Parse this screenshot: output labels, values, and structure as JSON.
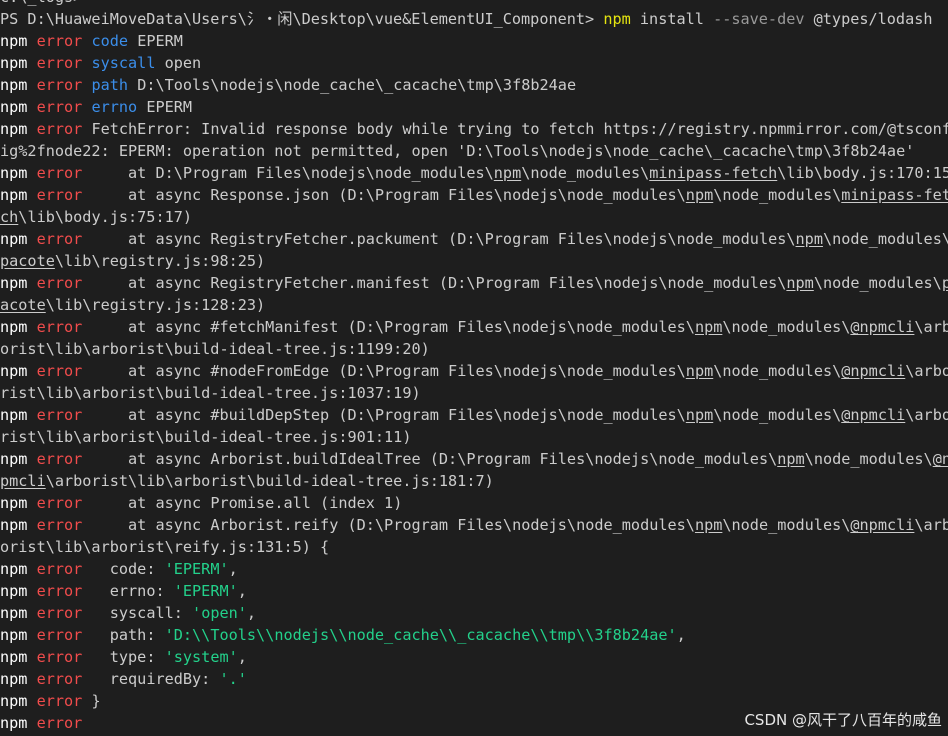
{
  "terminal": {
    "lines": [
      [
        {
          "t": "c:\\_logs>"
        }
      ],
      [
        {
          "t": "PS D:\\HuaweiMoveData\\Users\\氵・闲\\Desktop\\vue&ElementUI_Component> "
        },
        {
          "t": "npm",
          "c": "cmd"
        },
        {
          "t": " install "
        },
        {
          "t": "--save-dev",
          "c": "flag"
        },
        {
          "t": " @types/lodash"
        }
      ],
      [
        {
          "t": "npm",
          "c": "npm"
        },
        {
          "t": " "
        },
        {
          "t": "error",
          "c": "lvl"
        },
        {
          "t": " "
        },
        {
          "t": "code",
          "c": "key"
        },
        {
          "t": " EPERM"
        }
      ],
      [
        {
          "t": "npm",
          "c": "npm"
        },
        {
          "t": " "
        },
        {
          "t": "error",
          "c": "lvl"
        },
        {
          "t": " "
        },
        {
          "t": "syscall",
          "c": "key"
        },
        {
          "t": " open"
        }
      ],
      [
        {
          "t": "npm",
          "c": "npm"
        },
        {
          "t": " "
        },
        {
          "t": "error",
          "c": "lvl"
        },
        {
          "t": " "
        },
        {
          "t": "path",
          "c": "key"
        },
        {
          "t": " D:\\Tools\\nodejs\\node_cache\\_cacache\\tmp\\3f8b24ae"
        }
      ],
      [
        {
          "t": "npm",
          "c": "npm"
        },
        {
          "t": " "
        },
        {
          "t": "error",
          "c": "lvl"
        },
        {
          "t": " "
        },
        {
          "t": "errno",
          "c": "key"
        },
        {
          "t": " EPERM"
        }
      ],
      [
        {
          "t": "npm",
          "c": "npm"
        },
        {
          "t": " "
        },
        {
          "t": "error",
          "c": "lvl"
        },
        {
          "t": " FetchError: Invalid response body while trying to fetch https://registry.npmmirror.com/@tsconf"
        }
      ],
      [
        {
          "t": "ig%2fnode22: EPERM: operation not permitted, open 'D:\\Tools\\nodejs\\node_cache\\_cacache\\tmp\\3f8b24ae'"
        }
      ],
      [
        {
          "t": "npm",
          "c": "npm"
        },
        {
          "t": " "
        },
        {
          "t": "error",
          "c": "lvl"
        },
        {
          "t": "     at D:\\Program Files\\nodejs\\node_modules\\"
        },
        {
          "t": "npm",
          "c": "u"
        },
        {
          "t": "\\node_modules\\"
        },
        {
          "t": "minipass-fetch",
          "c": "u"
        },
        {
          "t": "\\lib\\body.js:170:15"
        }
      ],
      [
        {
          "t": "npm",
          "c": "npm"
        },
        {
          "t": " "
        },
        {
          "t": "error",
          "c": "lvl"
        },
        {
          "t": "     at async Response.json (D:\\Program Files\\nodejs\\node_modules\\"
        },
        {
          "t": "npm",
          "c": "u"
        },
        {
          "t": "\\node_modules\\"
        },
        {
          "t": "minipass-fet",
          "c": "u"
        }
      ],
      [
        {
          "t": "ch",
          "c": "u"
        },
        {
          "t": "\\lib\\body.js:75:17)"
        }
      ],
      [
        {
          "t": "npm",
          "c": "npm"
        },
        {
          "t": " "
        },
        {
          "t": "error",
          "c": "lvl"
        },
        {
          "t": "     at async RegistryFetcher.packument (D:\\Program Files\\nodejs\\node_modules\\"
        },
        {
          "t": "npm",
          "c": "u"
        },
        {
          "t": "\\node_modules\\"
        }
      ],
      [
        {
          "t": "pacote",
          "c": "u"
        },
        {
          "t": "\\lib\\registry.js:98:25)"
        }
      ],
      [
        {
          "t": "npm",
          "c": "npm"
        },
        {
          "t": " "
        },
        {
          "t": "error",
          "c": "lvl"
        },
        {
          "t": "     at async RegistryFetcher.manifest (D:\\Program Files\\nodejs\\node_modules\\"
        },
        {
          "t": "npm",
          "c": "u"
        },
        {
          "t": "\\node_modules\\"
        },
        {
          "t": "p",
          "c": "u"
        }
      ],
      [
        {
          "t": "acote",
          "c": "u"
        },
        {
          "t": "\\lib\\registry.js:128:23)"
        }
      ],
      [
        {
          "t": "npm",
          "c": "npm"
        },
        {
          "t": " "
        },
        {
          "t": "error",
          "c": "lvl"
        },
        {
          "t": "     at async #fetchManifest (D:\\Program Files\\nodejs\\node_modules\\"
        },
        {
          "t": "npm",
          "c": "u"
        },
        {
          "t": "\\node_modules\\"
        },
        {
          "t": "@npmcli",
          "c": "u"
        },
        {
          "t": "\\arb"
        }
      ],
      [
        {
          "t": "orist\\lib\\arborist\\build-ideal-tree.js:1199:20)"
        }
      ],
      [
        {
          "t": "npm",
          "c": "npm"
        },
        {
          "t": " "
        },
        {
          "t": "error",
          "c": "lvl"
        },
        {
          "t": "     at async #nodeFromEdge (D:\\Program Files\\nodejs\\node_modules\\"
        },
        {
          "t": "npm",
          "c": "u"
        },
        {
          "t": "\\node_modules\\"
        },
        {
          "t": "@npmcli",
          "c": "u"
        },
        {
          "t": "\\arbo"
        }
      ],
      [
        {
          "t": "rist\\lib\\arborist\\build-ideal-tree.js:1037:19)"
        }
      ],
      [
        {
          "t": "npm",
          "c": "npm"
        },
        {
          "t": " "
        },
        {
          "t": "error",
          "c": "lvl"
        },
        {
          "t": "     at async #buildDepStep (D:\\Program Files\\nodejs\\node_modules\\"
        },
        {
          "t": "npm",
          "c": "u"
        },
        {
          "t": "\\node_modules\\"
        },
        {
          "t": "@npmcli",
          "c": "u"
        },
        {
          "t": "\\arbo"
        }
      ],
      [
        {
          "t": "rist\\lib\\arborist\\build-ideal-tree.js:901:11)"
        }
      ],
      [
        {
          "t": "npm",
          "c": "npm"
        },
        {
          "t": " "
        },
        {
          "t": "error",
          "c": "lvl"
        },
        {
          "t": "     at async Arborist.buildIdealTree (D:\\Program Files\\nodejs\\node_modules\\"
        },
        {
          "t": "npm",
          "c": "u"
        },
        {
          "t": "\\node_modules\\"
        },
        {
          "t": "@n",
          "c": "u"
        }
      ],
      [
        {
          "t": "pmcli",
          "c": "u"
        },
        {
          "t": "\\arborist\\lib\\arborist\\build-ideal-tree.js:181:7)"
        }
      ],
      [
        {
          "t": "npm",
          "c": "npm"
        },
        {
          "t": " "
        },
        {
          "t": "error",
          "c": "lvl"
        },
        {
          "t": "     at async Promise.all (index 1)"
        }
      ],
      [
        {
          "t": "npm",
          "c": "npm"
        },
        {
          "t": " "
        },
        {
          "t": "error",
          "c": "lvl"
        },
        {
          "t": "     at async Arborist.reify (D:\\Program Files\\nodejs\\node_modules\\"
        },
        {
          "t": "npm",
          "c": "u"
        },
        {
          "t": "\\node_modules\\"
        },
        {
          "t": "@npmcli",
          "c": "u"
        },
        {
          "t": "\\arb"
        }
      ],
      [
        {
          "t": "orist\\lib\\arborist\\reify.js:131:5) {"
        }
      ],
      [
        {
          "t": "npm",
          "c": "npm"
        },
        {
          "t": " "
        },
        {
          "t": "error",
          "c": "lvl"
        },
        {
          "t": "   code: "
        },
        {
          "t": "'EPERM'",
          "c": "str"
        },
        {
          "t": ","
        }
      ],
      [
        {
          "t": "npm",
          "c": "npm"
        },
        {
          "t": " "
        },
        {
          "t": "error",
          "c": "lvl"
        },
        {
          "t": "   errno: "
        },
        {
          "t": "'EPERM'",
          "c": "str"
        },
        {
          "t": ","
        }
      ],
      [
        {
          "t": "npm",
          "c": "npm"
        },
        {
          "t": " "
        },
        {
          "t": "error",
          "c": "lvl"
        },
        {
          "t": "   syscall: "
        },
        {
          "t": "'open'",
          "c": "str"
        },
        {
          "t": ","
        }
      ],
      [
        {
          "t": "npm",
          "c": "npm"
        },
        {
          "t": " "
        },
        {
          "t": "error",
          "c": "lvl"
        },
        {
          "t": "   path: "
        },
        {
          "t": "'D:\\\\Tools\\\\nodejs\\\\node_cache\\\\_cacache\\\\tmp\\\\3f8b24ae'",
          "c": "str"
        },
        {
          "t": ","
        }
      ],
      [
        {
          "t": "npm",
          "c": "npm"
        },
        {
          "t": " "
        },
        {
          "t": "error",
          "c": "lvl"
        },
        {
          "t": "   type: "
        },
        {
          "t": "'system'",
          "c": "str"
        },
        {
          "t": ","
        }
      ],
      [
        {
          "t": "npm",
          "c": "npm"
        },
        {
          "t": " "
        },
        {
          "t": "error",
          "c": "lvl"
        },
        {
          "t": "   requiredBy: "
        },
        {
          "t": "'.'",
          "c": "str"
        }
      ],
      [
        {
          "t": "npm",
          "c": "npm"
        },
        {
          "t": " "
        },
        {
          "t": "error",
          "c": "lvl"
        },
        {
          "t": " }"
        }
      ],
      [
        {
          "t": "npm",
          "c": "npm"
        },
        {
          "t": " "
        },
        {
          "t": "error",
          "c": "lvl"
        }
      ]
    ]
  },
  "watermark": "CSDN @风干了八百年的咸鱼",
  "colors": {
    "background": "#1e1e1e",
    "text": "#cccccc",
    "npm": "#ffffff",
    "error": "#f14c4c",
    "key": "#3b8eea",
    "string": "#23d18b",
    "command": "#e5e510",
    "flag": "#999999"
  }
}
